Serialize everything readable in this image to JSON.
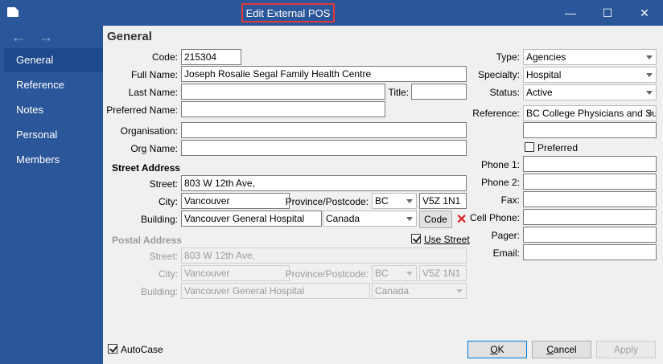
{
  "window": {
    "title": "Edit External POS",
    "minimize": "—",
    "maximize": "☐",
    "close": "✕"
  },
  "sidebar": {
    "back": "←",
    "forward": "→",
    "items": [
      "General",
      "Reference",
      "Notes",
      "Personal",
      "Members"
    ]
  },
  "main": {
    "heading": "General",
    "labels": {
      "code": "Code:",
      "full_name": "Full Name:",
      "last_name": "Last Name:",
      "title": "Title:",
      "preferred_name": "Preferred Name:",
      "organisation": "Organisation:",
      "org_name": "Org Name:",
      "street": "Street:",
      "city": "City:",
      "province": "Province/Postcode:",
      "building": "Building:",
      "type": "Type:",
      "specialty": "Specialty:",
      "status": "Status:",
      "reference": "Reference:",
      "preferred": "Preferred",
      "phone1": "Phone 1:",
      "phone2": "Phone 2:",
      "fax": "Fax:",
      "cell": "Cell Phone:",
      "pager": "Pager:",
      "email": "Email:"
    },
    "values": {
      "code": "215304",
      "full_name": "Joseph Rosalie Segal Family Health Centre",
      "last_name": "",
      "title": "",
      "preferred_name": "",
      "organisation": "",
      "org_name": "",
      "type": "Agencies",
      "specialty": "Hospital",
      "status": "Active",
      "reference": "BC College Physicians and Sur",
      "reference_extra": "",
      "phone1": "",
      "phone2": "",
      "fax": "",
      "cell": "",
      "pager": "",
      "email": ""
    },
    "street_address": {
      "heading": "Street Address",
      "street": "803 W 12th Ave,",
      "city": "Vancouver",
      "province": "BC",
      "postcode": "V5Z 1N1",
      "building": "Vancouver General Hospital",
      "country": "Canada",
      "code_button": "Code",
      "clear_icon": "✕"
    },
    "postal_address": {
      "heading": "Postal Address",
      "use_street": "Use Street",
      "street": "803 W 12th Ave,",
      "city": "Vancouver",
      "province": "BC",
      "postcode": "V5Z 1N1",
      "building": "Vancouver General Hospital",
      "country": "Canada"
    }
  },
  "footer": {
    "autocase": "AutoCase",
    "ok_pre": "",
    "ok_u": "O",
    "ok_post": "K",
    "cancel_u": "C",
    "cancel_post": "ancel",
    "apply": "Apply"
  }
}
